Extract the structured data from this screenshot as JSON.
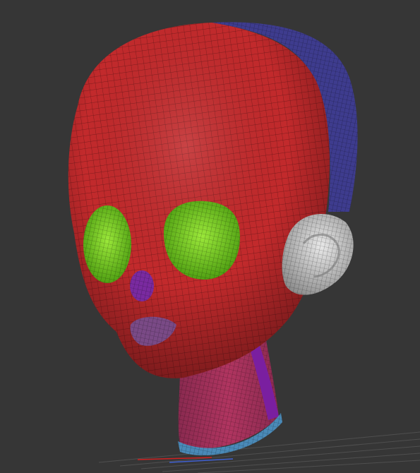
{
  "viewport": {
    "background_color": "#363636",
    "grid_line_color": "#5a5a5a"
  },
  "model": {
    "subject": "stylized-head-mesh",
    "wireframe": true,
    "polygroups": [
      {
        "name": "head",
        "color": "#c22a2c"
      },
      {
        "name": "back-of-head",
        "color": "#3e3c8e"
      },
      {
        "name": "eyes",
        "color": "#6bc21a"
      },
      {
        "name": "nose",
        "color": "#7a2aa0"
      },
      {
        "name": "lips",
        "color": "#7a4a86"
      },
      {
        "name": "ears",
        "color": "#c8c8c8"
      },
      {
        "name": "neck",
        "color": "#a8325a"
      },
      {
        "name": "neck-side",
        "color": "#7a1fa0"
      },
      {
        "name": "neck-rim",
        "color": "#4a8ab8"
      }
    ]
  },
  "axis_gizmo": {
    "x_color": "#d02020",
    "z_color": "#4060d0"
  }
}
